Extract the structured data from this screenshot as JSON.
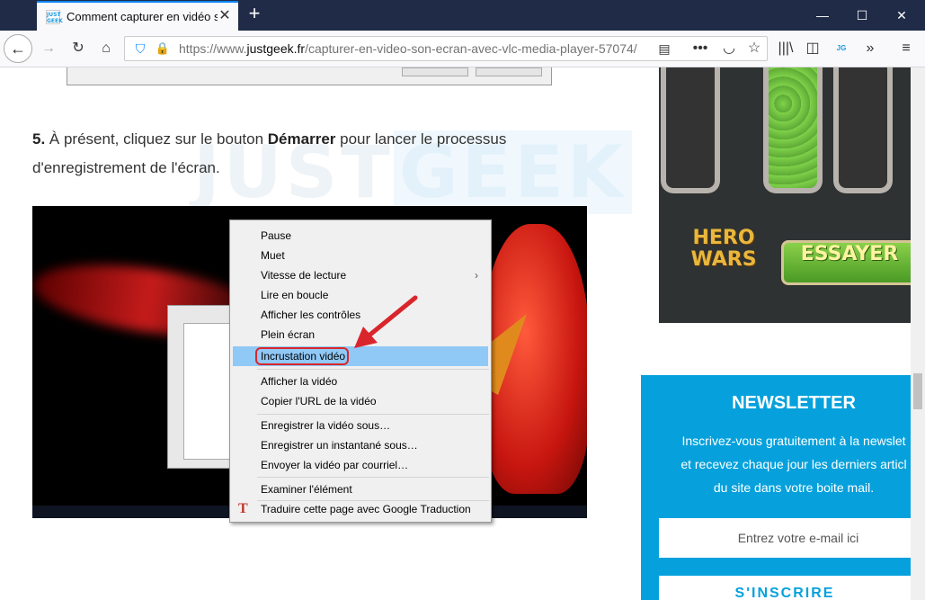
{
  "browser": {
    "tab_title": "Comment capturer en vidéo so",
    "tab_favicon_text": "JUST GEEK",
    "url_prefix": "https://www.",
    "url_domain": "justgeek.fr",
    "url_path": "/capturer-en-video-son-ecran-avec-vlc-media-player-57074/"
  },
  "article": {
    "step_number": "5.",
    "step_text_1": " À présent, cliquez sur le bouton ",
    "step_bold": "Démarrer",
    "step_text_2": " pour lancer le processus d'enregistrement de l'écran.",
    "watermark_1": "JUST",
    "watermark_2": "GEEK"
  },
  "context_menu": {
    "items": [
      "Pause",
      "Muet",
      "Vitesse de lecture",
      "Lire en boucle",
      "Afficher les contrôles",
      "Plein écran",
      "Incrustation vidéo",
      "Afficher la vidéo",
      "Copier l'URL de la vidéo",
      "Enregistrer la vidéo sous…",
      "Enregistrer un instantané sous…",
      "Envoyer la vidéo par courriel…",
      "Examiner l'élément",
      "Traduire cette page avec Google Traduction"
    ],
    "highlighted_index": 6
  },
  "ad": {
    "logo_text": "HERO WARS",
    "button": "ESSAYER"
  },
  "newsletter": {
    "title": "NEWSLETTER",
    "desc_1": "Inscrivez-vous gratuitement à la newslet",
    "desc_2": "et recevez chaque jour les derniers articl",
    "desc_3": "du site dans votre boite mail.",
    "input_placeholder": "Entrez votre e-mail ici",
    "button": "S'INSCRIRE"
  },
  "colors": {
    "titlebar": "#1f2b47",
    "accent": "#0a84ff",
    "newsletter_bg": "#06a1dc",
    "highlight": "#90c8f6",
    "annotation_red": "#d9262c"
  }
}
